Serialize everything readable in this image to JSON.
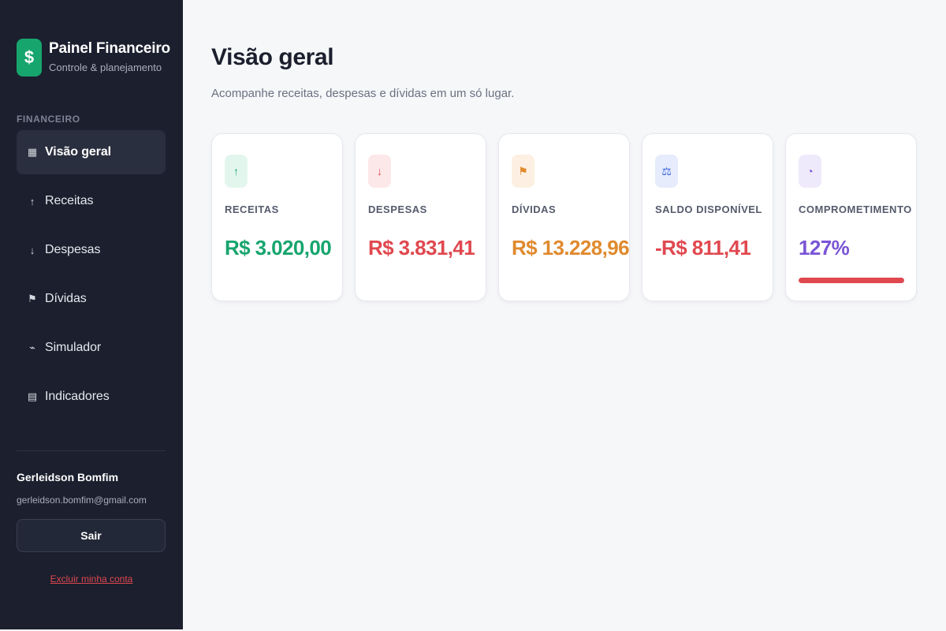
{
  "brand": {
    "logo": "$",
    "title": "Painel Financeiro",
    "subtitle": "Controle & planejamento"
  },
  "sidebar": {
    "section_label": "FINANCEIRO",
    "items": [
      {
        "label": "Visão geral",
        "icon": "▦",
        "icon_name": "grid-icon",
        "active": true
      },
      {
        "label": "Receitas",
        "icon": "↑",
        "icon_name": "arrow-up-icon",
        "active": false
      },
      {
        "label": "Despesas",
        "icon": "↓",
        "icon_name": "arrow-down-icon",
        "active": false
      },
      {
        "label": "Dívidas",
        "icon": "⚑",
        "icon_name": "flag-icon",
        "active": false
      },
      {
        "label": "Simulador",
        "icon": "⌁",
        "icon_name": "simulator-icon",
        "active": false
      },
      {
        "label": "Indicadores",
        "icon": "▤",
        "icon_name": "report-icon",
        "active": false
      }
    ]
  },
  "user": {
    "name": "Gerleidson Bomfim",
    "email": "gerleidson.bomfim@gmail.com",
    "logout_label": "Sair",
    "delete_label": "Excluir minha conta"
  },
  "main": {
    "title": "Visão geral",
    "subtitle": "Acompanhe receitas, despesas e dívidas em um só lugar."
  },
  "cards": [
    {
      "label": "RECEITAS",
      "value": "R$ 3.020,00",
      "icon": "↑",
      "icon_name": "arrow-up-icon",
      "color": "#17a56e",
      "icon_bg": "#e3f6ee"
    },
    {
      "label": "DESPESAS",
      "value": "R$ 3.831,41",
      "icon": "↓",
      "icon_name": "arrow-down-icon",
      "color": "#e0484f",
      "icon_bg": "#fde8e9"
    },
    {
      "label": "DÍVIDAS",
      "value": "R$ 13.228,96",
      "icon": "⚑",
      "icon_name": "flag-icon",
      "color": "#e08a2e",
      "icon_bg": "#fdf0e2"
    },
    {
      "label": "SALDO DISPONÍVEL",
      "value": "-R$ 811,41",
      "icon": "⚖",
      "icon_name": "balance-icon",
      "color": "#e0484f",
      "icon_bg": "#e6ecfb",
      "icon_color": "#3a62d6"
    },
    {
      "label": "COMPROMETIMENTO",
      "value": "127%",
      "icon": "◔",
      "icon_name": "pie-icon",
      "color": "#7a55d6",
      "icon_bg": "#efeafb",
      "progress": 1.0,
      "progress_color": "#e0484f"
    }
  ]
}
